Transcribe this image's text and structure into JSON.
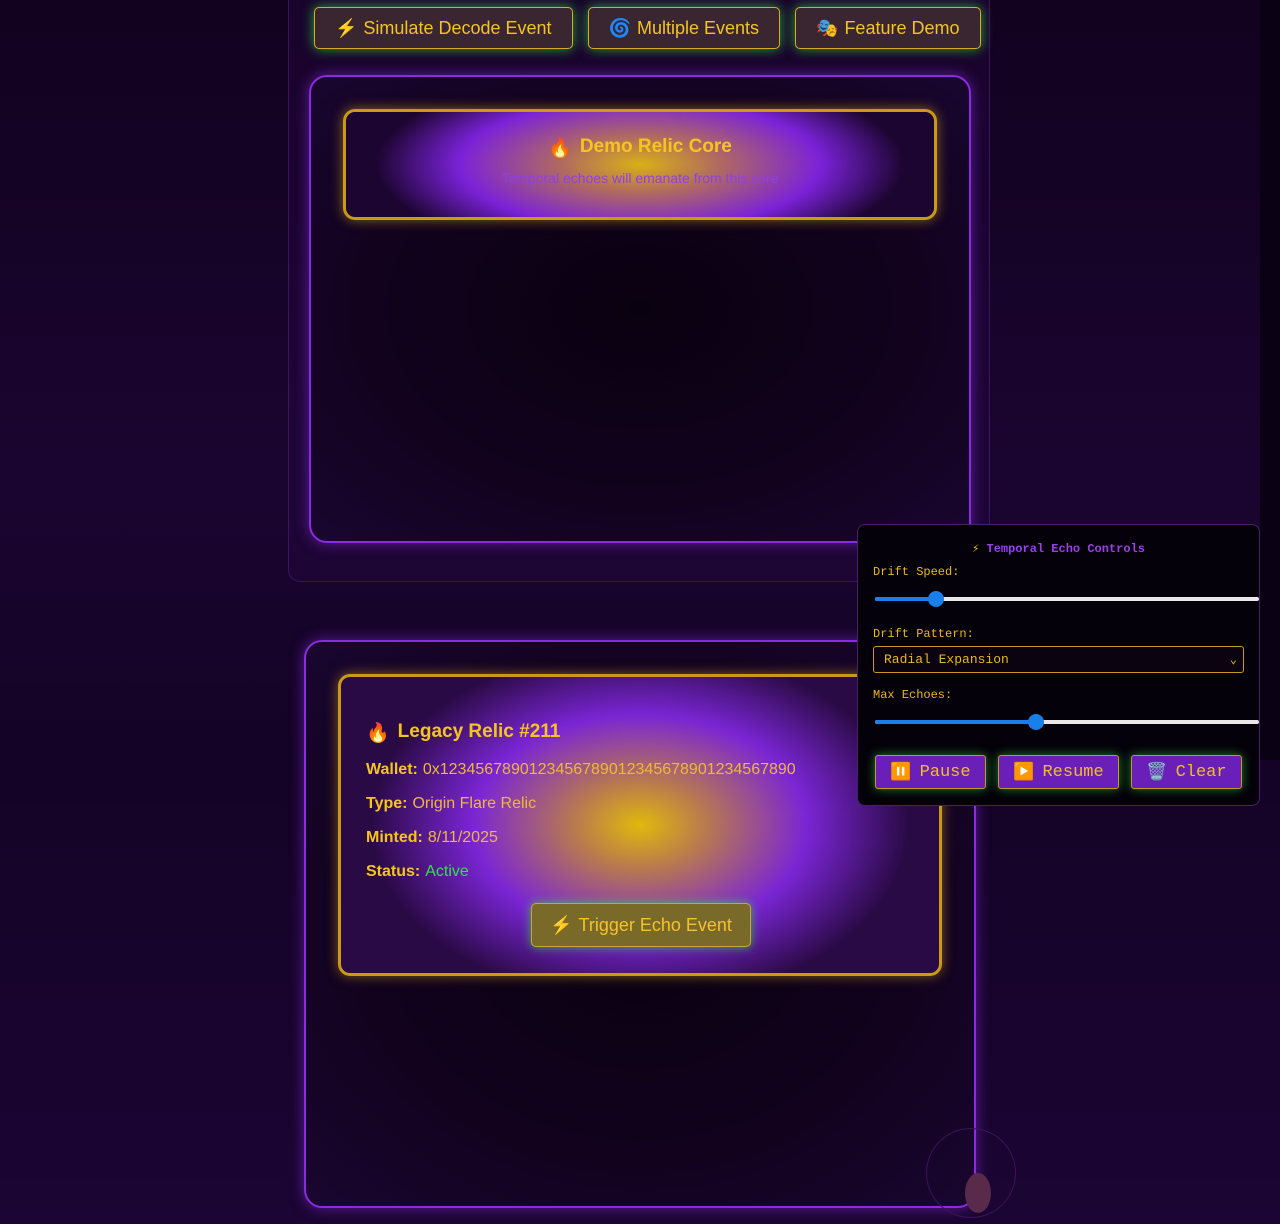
{
  "demo_buttons": [
    {
      "icon": "⚡",
      "label": "Simulate Decode Event"
    },
    {
      "icon": "🌀",
      "label": "Multiple Events"
    },
    {
      "icon": "🎭",
      "label": "Feature Demo"
    }
  ],
  "core": {
    "icon": "🔥",
    "title": "Demo Relic Core",
    "subtitle": "Temporal echoes will emanate from this core"
  },
  "relic": {
    "icon": "🔥",
    "title": "Legacy Relic #211",
    "wallet_label": "Wallet:",
    "wallet": "0x1234567890123456789012345678901234567890",
    "type_label": "Type:",
    "type": "Origin Flare Relic",
    "minted_label": "Minted:",
    "minted": "8/11/2025",
    "status_label": "Status:",
    "status": "Active",
    "status_color": "#2fe24a",
    "trigger_icon": "⚡",
    "trigger_label": "Trigger Echo Event"
  },
  "controls": {
    "title_icon": "⚡",
    "title": "Temporal Echo Controls",
    "drift_speed_label": "Drift Speed:",
    "drift_speed_fraction": 0.16,
    "drift_pattern_label": "Drift Pattern:",
    "drift_pattern_value": "Radial Expansion",
    "max_echoes_label": "Max Echoes:",
    "max_echoes_fraction": 0.42,
    "buttons": [
      {
        "icon": "⏸️",
        "label": "Pause"
      },
      {
        "icon": "▶️",
        "label": "Resume"
      },
      {
        "icon": "🗑️",
        "label": "Clear"
      }
    ]
  },
  "colors": {
    "accent_gold": "#f6c51d",
    "accent_purple": "#8a2be2",
    "glow_green": "#2edc3c",
    "slider_blue": "#1a7fe8"
  }
}
